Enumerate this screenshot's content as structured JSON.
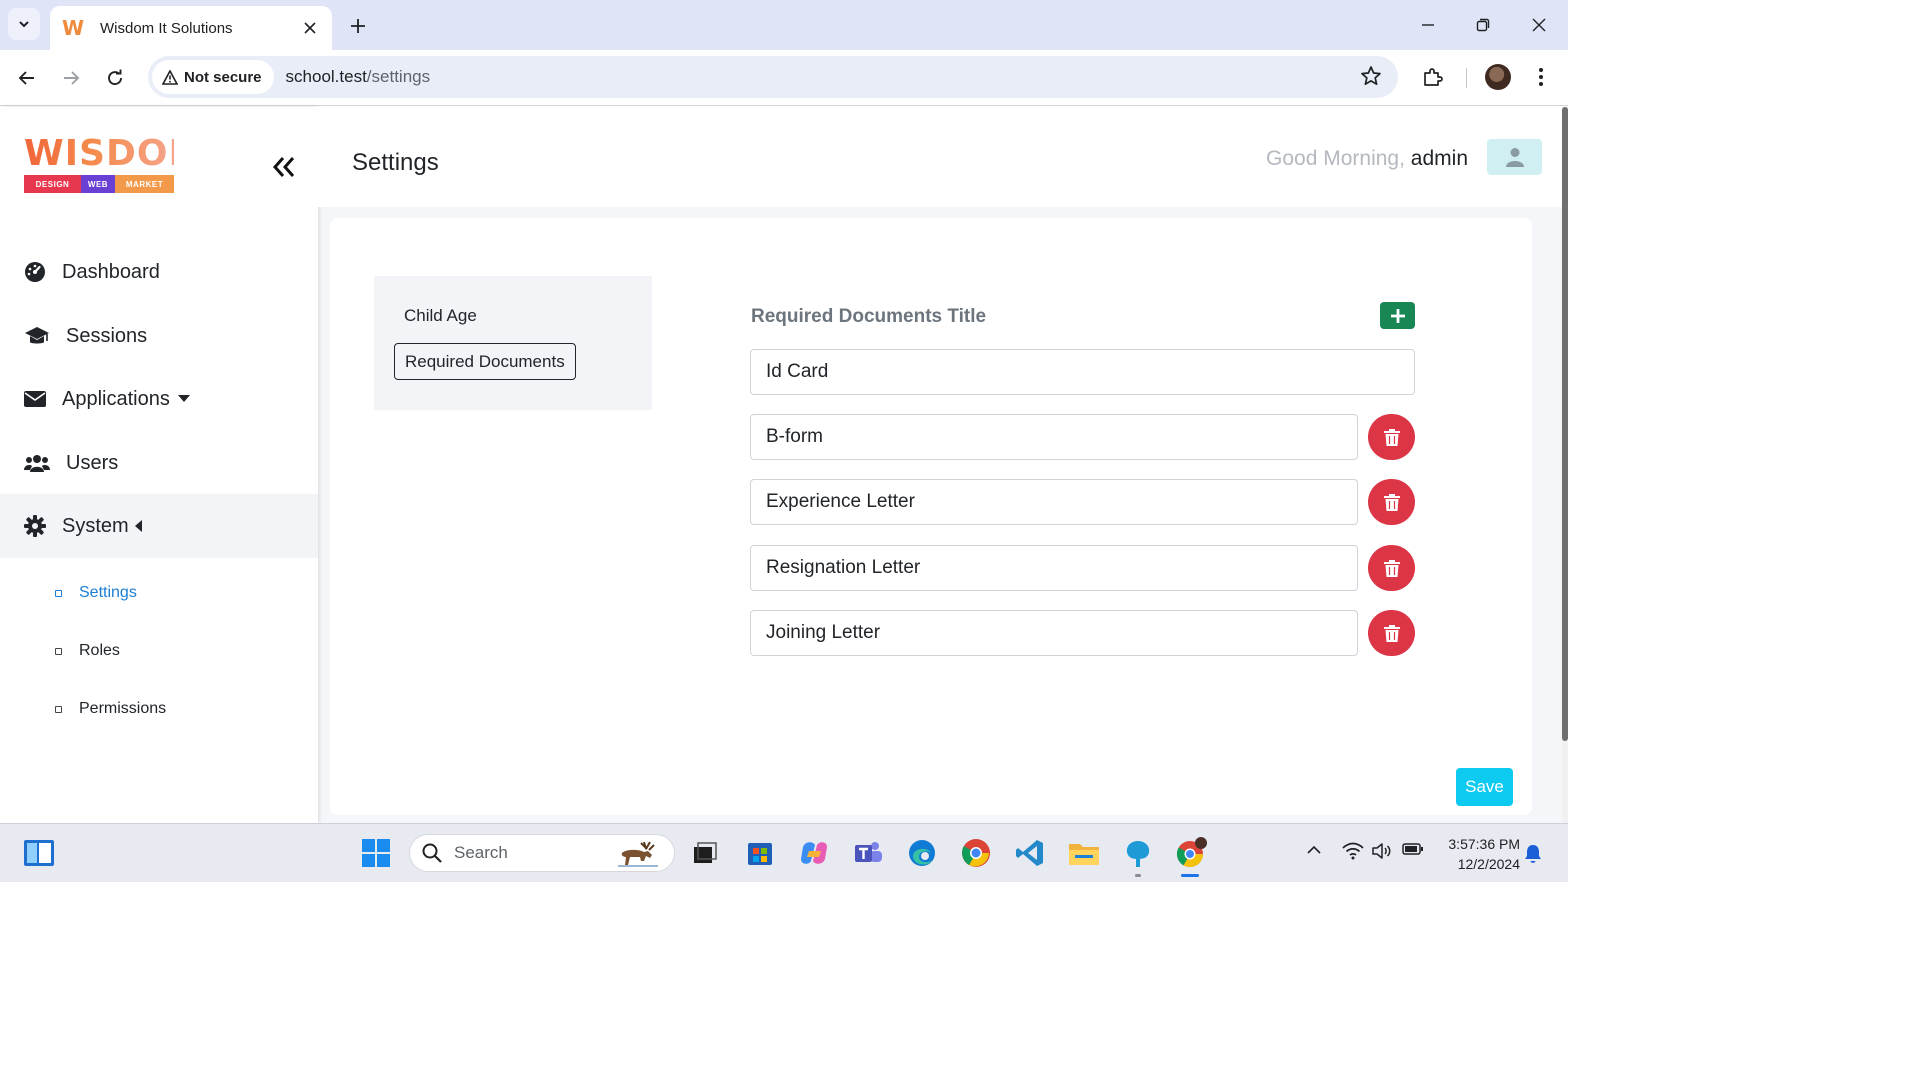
{
  "browser": {
    "tab_title": "Wisdom It Solutions",
    "security_label": "Not secure",
    "url_host": "school.test",
    "url_path": "/settings"
  },
  "brand": {
    "logo_word": "WISDOM",
    "logo_tags": [
      "DESIGN",
      "WEB",
      "MARKET"
    ]
  },
  "sidebar": {
    "items": [
      {
        "label": "Dashboard",
        "icon": "dashboard-icon"
      },
      {
        "label": "Sessions",
        "icon": "graduation-cap-icon"
      },
      {
        "label": "Applications",
        "icon": "envelope-icon"
      },
      {
        "label": "Users",
        "icon": "users-icon"
      },
      {
        "label": "System",
        "icon": "gear-icon"
      }
    ],
    "sub_items": [
      {
        "label": "Settings"
      },
      {
        "label": "Roles"
      },
      {
        "label": "Permissions"
      }
    ]
  },
  "header": {
    "title": "Settings",
    "greeting": "Good Morning,",
    "username": "admin"
  },
  "settings": {
    "nav": [
      "Child Age",
      "Required Documents"
    ],
    "section_title": "Required Documents Title",
    "documents": [
      "Id Card",
      "B-form",
      "Experience Letter",
      "Resignation Letter",
      "Joining Letter"
    ],
    "save_label": "Save"
  },
  "taskbar": {
    "search_placeholder": "Search",
    "time": "3:57:36 PM",
    "date": "12/2/2024"
  },
  "colors": {
    "add_button": "#198754",
    "delete_button": "#dc3545",
    "save_button": "#0dcaf0",
    "active_link": "#1a7fd4"
  }
}
